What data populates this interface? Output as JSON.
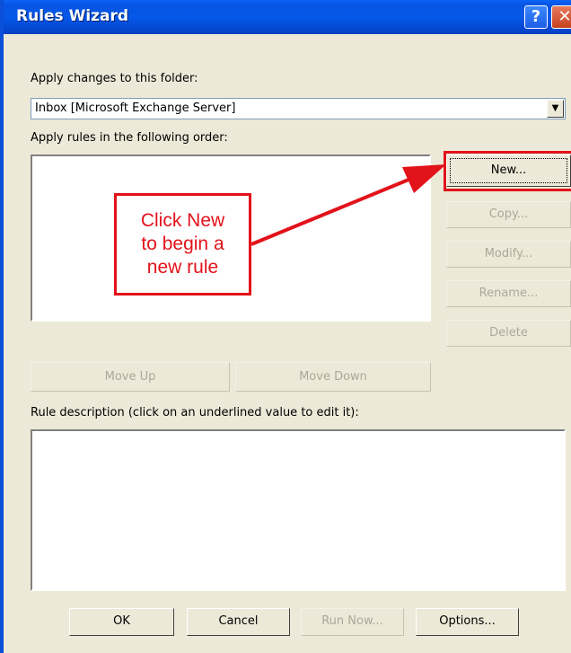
{
  "window": {
    "title": "Rules Wizard"
  },
  "titlebar": {
    "help_glyph": "?",
    "close_glyph": "✕"
  },
  "folder": {
    "label": "Apply changes to this folder:",
    "value": "Inbox [Microsoft Exchange Server]",
    "arrow_glyph": "▼"
  },
  "rules": {
    "label": "Apply rules in the following order:",
    "buttons": {
      "new": "New...",
      "copy": "Copy...",
      "modify": "Modify...",
      "rename": "Rename...",
      "delete": "Delete"
    },
    "move_up": "Move Up",
    "move_down": "Move Down"
  },
  "description": {
    "label": "Rule description (click on an underlined value to edit it):"
  },
  "footer": {
    "ok": "OK",
    "cancel": "Cancel",
    "run_now": "Run Now...",
    "options": "Options..."
  },
  "annotation": {
    "lines": [
      "Click New",
      "to begin a",
      "new rule"
    ],
    "color": "#e2121a"
  },
  "colors": {
    "titlebar": "#0558e8",
    "dialog_bg": "#ece9d8",
    "disabled_text": "#aca899"
  }
}
